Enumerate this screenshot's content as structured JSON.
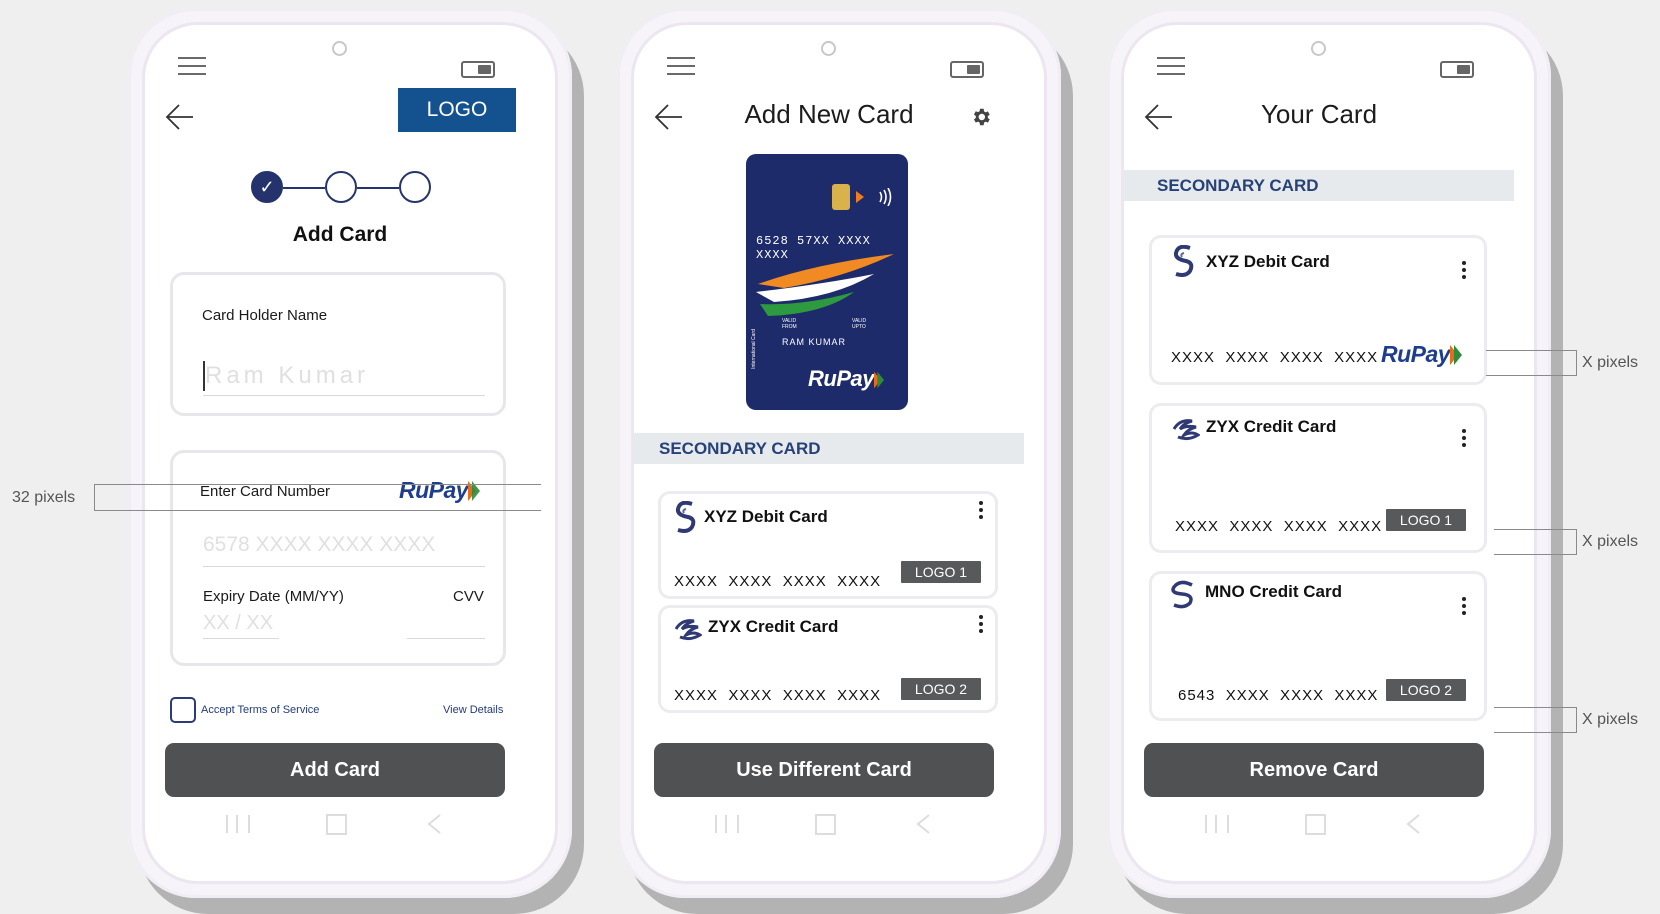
{
  "screen1": {
    "logo": "LOGO",
    "step_title": "Add Card",
    "holder_label": "Card Holder Name",
    "holder_placeholder": "Ram Kumar",
    "card_number_label": "Enter Card Number",
    "card_number_placeholder": "6578 XXXX XXXX XXXX",
    "brand": "RuPay",
    "expiry_label": "Expiry Date (MM/YY)",
    "expiry_placeholder": "XX / XX",
    "cvv_label": "CVV",
    "terms": "Accept Terms of Service",
    "view_details": "View Details",
    "button": "Add Card"
  },
  "screen2": {
    "title": "Add New Card",
    "card_preview": {
      "number": "6528 57XX XXXX XXXX",
      "valid_from": "VALID FROM",
      "valid_upto": "VALID UPTO",
      "holder": "RAM KUMAR",
      "side_text": "International Card",
      "brand": "RuPay"
    },
    "section": "SECONDARY CARD",
    "cards": [
      {
        "name": "XYZ Debit Card",
        "number": "XXXX  XXXX  XXXX  XXXX",
        "logo": "LOGO 1"
      },
      {
        "name": "ZYX Credit Card",
        "number": "XXXX  XXXX  XXXX  XXXX",
        "logo": "LOGO 2"
      }
    ],
    "button": "Use Different Card"
  },
  "screen3": {
    "title": "Your Card",
    "section": "SECONDARY CARD",
    "cards": [
      {
        "name": "XYZ Debit Card",
        "number": "XXXX  XXXX  XXXX  XXXX",
        "logo": "RuPay"
      },
      {
        "name": "ZYX Credit Card",
        "number": "XXXX  XXXX  XXXX  XXXX",
        "logo": "LOGO 1"
      },
      {
        "name": "MNO Credit Card",
        "number": "6543  XXXX  XXXX  XXXX",
        "logo": "LOGO 2"
      }
    ],
    "button": "Remove Card"
  },
  "annotations": {
    "left": "32 pixels",
    "right": [
      "X pixels",
      "X pixels",
      "X pixels"
    ]
  },
  "colors": {
    "primary_dark": "#4f5152",
    "navy": "#26346a",
    "logo_blue": "#14518f",
    "section_text": "#274278"
  }
}
